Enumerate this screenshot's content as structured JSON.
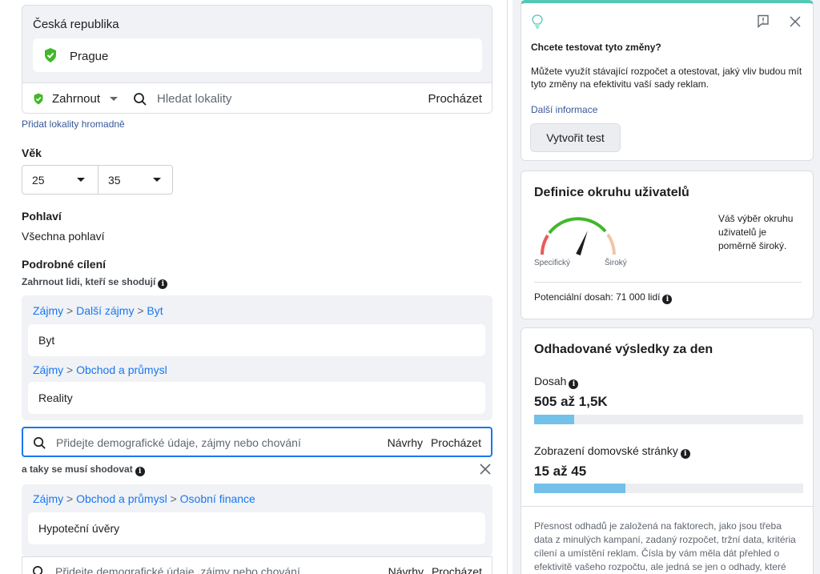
{
  "location": {
    "country": "Česká republika",
    "city": "Prague",
    "include_label": "Zahrnout",
    "search_placeholder": "Hledat lokality",
    "browse_label": "Procházet",
    "bulk_link": "Přidat lokality hromadně"
  },
  "age": {
    "title": "Věk",
    "min": "25",
    "max": "35"
  },
  "gender": {
    "title": "Pohlaví",
    "value": "Všechna pohlaví"
  },
  "detailed": {
    "title": "Podrobné cílení",
    "include_hint": "Zahrnout lidi, kteří se shodují",
    "groups1": [
      {
        "path": [
          "Zájmy",
          "Další zájmy",
          "Byt"
        ],
        "item": "Byt"
      },
      {
        "path": [
          "Zájmy",
          "Obchod a průmysl"
        ],
        "item": "Reality"
      }
    ],
    "search_placeholder": "Přidejte demografické údaje, zájmy nebo chování",
    "suggestions_label": "Návrhy",
    "browse_label": "Procházet",
    "must_match_hint": "a taky se musí shodovat",
    "groups2": [
      {
        "path": [
          "Zájmy",
          "Obchod a průmysl",
          "Osobní finance"
        ],
        "item": "Hypoteční úvěry"
      }
    ]
  },
  "test_card": {
    "question": "Chcete testovat tyto změny?",
    "description": "Můžete využít stávající rozpočet a otestovat, jaký vliv budou mít tyto změny na efektivitu vaší sady reklam.",
    "more_link": "Další informace",
    "button_label": "Vytvořit test",
    "accent_color": "#54c7b5"
  },
  "audience_card": {
    "title": "Definice okruhu uživatelů",
    "label_specific": "Specifický",
    "label_broad": "Široký",
    "verdict": "Váš výběr okruhu uživatelů je poměrně široký.",
    "reach_text": "Potenciální dosah: 71 000 lidí",
    "gauge_level": 0.62
  },
  "results_card": {
    "title": "Odhadované výsledky za den",
    "reach_label": "Dosah",
    "reach_value": "505 až 1,5K",
    "reach_fill": 0.15,
    "views_label": "Zobrazení domovské stránky",
    "views_value": "15 až 45",
    "views_fill": 0.34,
    "footnote": "Přesnost odhadů je založená na faktorech, jako jsou třeba data z minulých kampaní, zadaný rozpočet, tržní data, kritéria cílení a umístění reklam. Čísla by vám měla dát přehled o efektivitě vašeho rozpočtu, ale jedná se jen o odhady, které nejsou zaručené."
  },
  "colors": {
    "link": "#1877f2",
    "pin": "#42b72a",
    "bar_fill": "#73c0e8"
  }
}
